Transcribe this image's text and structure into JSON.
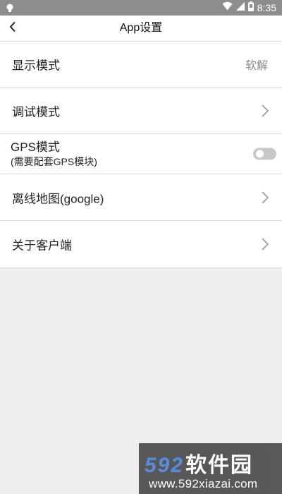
{
  "status_bar": {
    "time": "8:35",
    "icons": [
      "notification-bulb-icon",
      "wifi-icon",
      "cell-signal-icon",
      "battery-icon"
    ]
  },
  "header": {
    "title": "App设置",
    "back_icon": "chevron-left-icon"
  },
  "settings": {
    "display_mode": {
      "label": "显示模式",
      "value": "软解"
    },
    "debug_mode": {
      "label": "调试模式",
      "icon": "chevron-right-icon"
    },
    "gps_mode": {
      "label": "GPS模式",
      "sublabel": "(需要配套GPS模块)",
      "enabled": false
    },
    "offline_map": {
      "label": "离线地图(google)",
      "icon": "chevron-right-icon"
    },
    "about": {
      "label": "关于客户端",
      "icon": "chevron-right-icon"
    }
  },
  "watermark": {
    "brand_number": "592",
    "brand_text": "软件园",
    "url": "www.592xiazai.com"
  },
  "colors": {
    "status_bar": "#8d8d8d",
    "background": "#efefef",
    "row_background": "#ffffff",
    "divider": "#dcdcdc",
    "toggle_off": "#c8c8c8",
    "watermark_blue": "#4a86e0"
  }
}
